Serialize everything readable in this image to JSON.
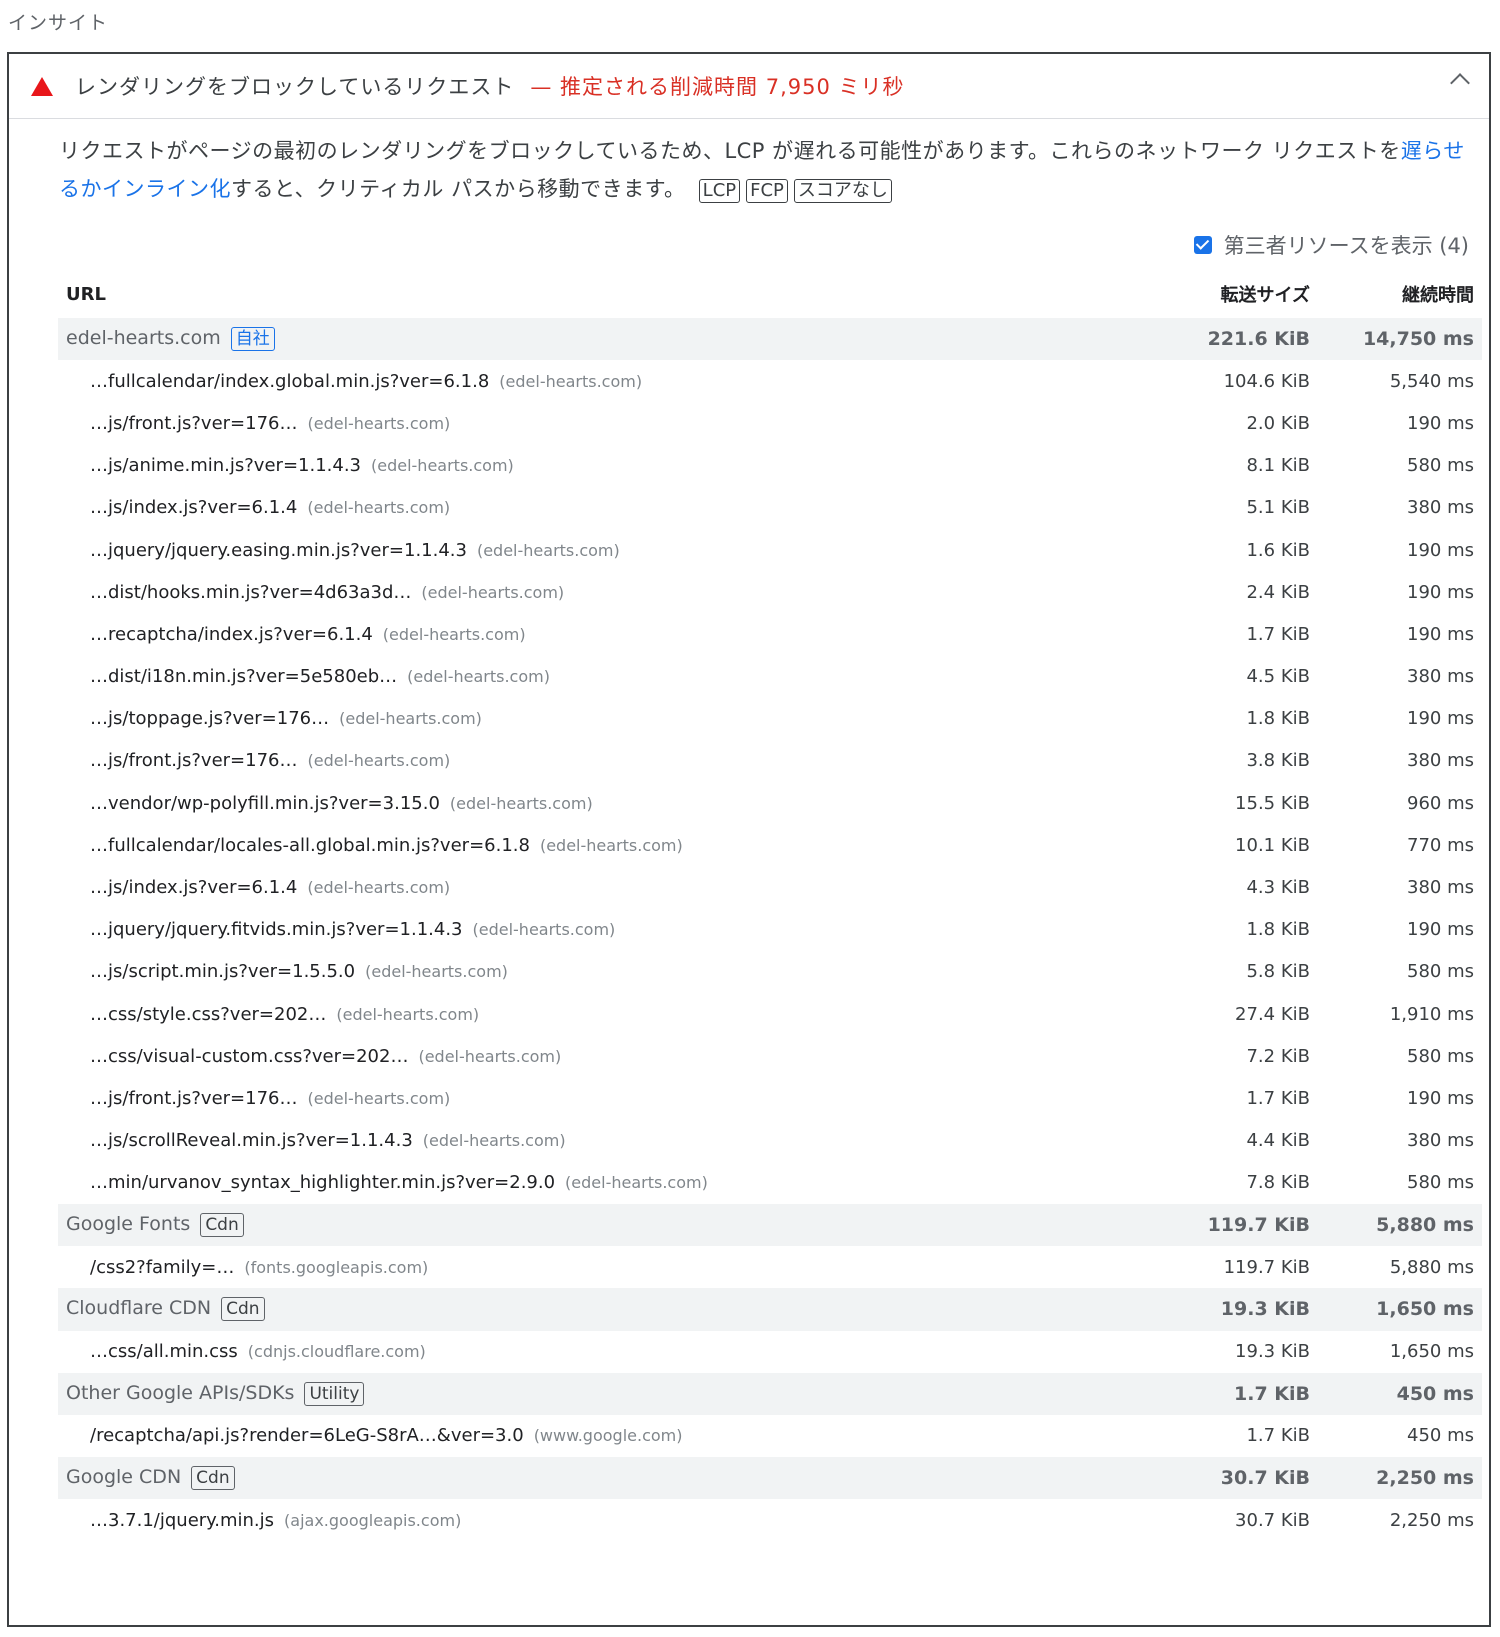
{
  "section_title": "インサイト",
  "audit": {
    "title": "レンダリングをブロックしているリクエスト",
    "savings": "— 推定される削減時間 7,950 ミリ秒",
    "desc_pre": "リクエストがページの最初のレンダリングをブロックしているため、LCP が遅れる可能性があります。これらのネットワーク リクエストを",
    "desc_link": "遅らせるかインライン化",
    "desc_post": "すると、クリティカル パスから移動できます。",
    "tags": [
      "LCP",
      "FCP",
      "スコアなし"
    ]
  },
  "third_party_label": "第三者リソースを表示 (4)",
  "columns": {
    "url": "URL",
    "size": "転送サイズ",
    "duration": "継続時間"
  },
  "rows": [
    {
      "type": "group",
      "name": "edel-hearts.com",
      "badge": "自社",
      "badge_first": true,
      "size": "221.6 KiB",
      "dur": "14,750 ms"
    },
    {
      "type": "item",
      "url": "…fullcalendar/index.global.min.js?ver=6.1.8",
      "host": "(edel-hearts.com)",
      "size": "104.6 KiB",
      "dur": "5,540 ms"
    },
    {
      "type": "item",
      "url": "…js/front.js?ver=176…",
      "host": "(edel-hearts.com)",
      "size": "2.0 KiB",
      "dur": "190 ms"
    },
    {
      "type": "item",
      "url": "…js/anime.min.js?ver=1.1.4.3",
      "host": "(edel-hearts.com)",
      "size": "8.1 KiB",
      "dur": "580 ms"
    },
    {
      "type": "item",
      "url": "…js/index.js?ver=6.1.4",
      "host": "(edel-hearts.com)",
      "size": "5.1 KiB",
      "dur": "380 ms"
    },
    {
      "type": "item",
      "url": "…jquery/jquery.easing.min.js?ver=1.1.4.3",
      "host": "(edel-hearts.com)",
      "size": "1.6 KiB",
      "dur": "190 ms"
    },
    {
      "type": "item",
      "url": "…dist/hooks.min.js?ver=4d63a3d…",
      "host": "(edel-hearts.com)",
      "size": "2.4 KiB",
      "dur": "190 ms"
    },
    {
      "type": "item",
      "url": "…recaptcha/index.js?ver=6.1.4",
      "host": "(edel-hearts.com)",
      "size": "1.7 KiB",
      "dur": "190 ms"
    },
    {
      "type": "item",
      "url": "…dist/i18n.min.js?ver=5e580eb…",
      "host": "(edel-hearts.com)",
      "size": "4.5 KiB",
      "dur": "380 ms"
    },
    {
      "type": "item",
      "url": "…js/toppage.js?ver=176…",
      "host": "(edel-hearts.com)",
      "size": "1.8 KiB",
      "dur": "190 ms"
    },
    {
      "type": "item",
      "url": "…js/front.js?ver=176…",
      "host": "(edel-hearts.com)",
      "size": "3.8 KiB",
      "dur": "380 ms"
    },
    {
      "type": "item",
      "url": "…vendor/wp-polyfill.min.js?ver=3.15.0",
      "host": "(edel-hearts.com)",
      "size": "15.5 KiB",
      "dur": "960 ms"
    },
    {
      "type": "item",
      "url": "…fullcalendar/locales-all.global.min.js?ver=6.1.8",
      "host": "(edel-hearts.com)",
      "size": "10.1 KiB",
      "dur": "770 ms"
    },
    {
      "type": "item",
      "url": "…js/index.js?ver=6.1.4",
      "host": "(edel-hearts.com)",
      "size": "4.3 KiB",
      "dur": "380 ms"
    },
    {
      "type": "item",
      "url": "…jquery/jquery.fitvids.min.js?ver=1.1.4.3",
      "host": "(edel-hearts.com)",
      "size": "1.8 KiB",
      "dur": "190 ms"
    },
    {
      "type": "item",
      "url": "…js/script.min.js?ver=1.5.5.0",
      "host": "(edel-hearts.com)",
      "size": "5.8 KiB",
      "dur": "580 ms"
    },
    {
      "type": "item",
      "url": "…css/style.css?ver=202…",
      "host": "(edel-hearts.com)",
      "size": "27.4 KiB",
      "dur": "1,910 ms"
    },
    {
      "type": "item",
      "url": "…css/visual-custom.css?ver=202…",
      "host": "(edel-hearts.com)",
      "size": "7.2 KiB",
      "dur": "580 ms"
    },
    {
      "type": "item",
      "url": "…js/front.js?ver=176…",
      "host": "(edel-hearts.com)",
      "size": "1.7 KiB",
      "dur": "190 ms"
    },
    {
      "type": "item",
      "url": "…js/scrollReveal.min.js?ver=1.1.4.3",
      "host": "(edel-hearts.com)",
      "size": "4.4 KiB",
      "dur": "380 ms"
    },
    {
      "type": "item",
      "url": "…min/urvanov_syntax_highlighter.min.js?ver=2.9.0",
      "host": "(edel-hearts.com)",
      "size": "7.8 KiB",
      "dur": "580 ms"
    },
    {
      "type": "group",
      "name": "Google Fonts",
      "badge": "Cdn",
      "badge_first": false,
      "size": "119.7 KiB",
      "dur": "5,880 ms"
    },
    {
      "type": "item",
      "url": "/css2?family=…",
      "host": "(fonts.googleapis.com)",
      "size": "119.7 KiB",
      "dur": "5,880 ms"
    },
    {
      "type": "group",
      "name": "Cloudflare CDN",
      "badge": "Cdn",
      "badge_first": false,
      "size": "19.3 KiB",
      "dur": "1,650 ms"
    },
    {
      "type": "item",
      "url": "…css/all.min.css",
      "host": "(cdnjs.cloudflare.com)",
      "size": "19.3 KiB",
      "dur": "1,650 ms"
    },
    {
      "type": "group",
      "name": "Other Google APIs/SDKs",
      "badge": "Utility",
      "badge_first": false,
      "size": "1.7 KiB",
      "dur": "450 ms"
    },
    {
      "type": "item",
      "url": "/recaptcha/api.js?render=6LeG-S8rA…&ver=3.0",
      "host": "(www.google.com)",
      "size": "1.7 KiB",
      "dur": "450 ms"
    },
    {
      "type": "group",
      "name": "Google CDN",
      "badge": "Cdn",
      "badge_first": false,
      "size": "30.7 KiB",
      "dur": "2,250 ms"
    },
    {
      "type": "item",
      "url": "…3.7.1/jquery.min.js",
      "host": "(ajax.googleapis.com)",
      "size": "30.7 KiB",
      "dur": "2,250 ms"
    }
  ]
}
